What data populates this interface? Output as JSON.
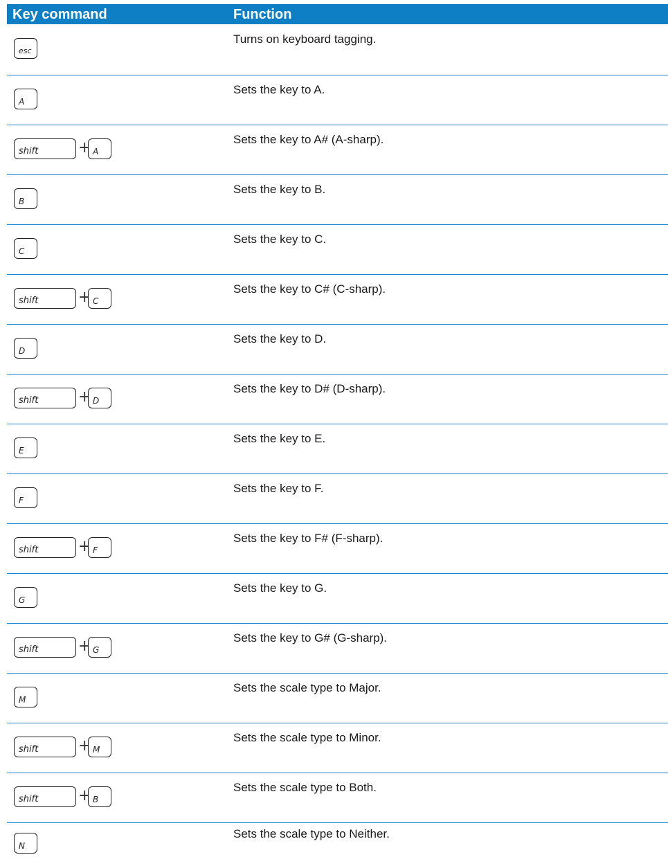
{
  "header": {
    "col1": "Key command",
    "col2": "Function"
  },
  "rows": [
    {
      "keys": [
        "esc"
      ],
      "desc": "Turns on keyboard tagging."
    },
    {
      "keys": [
        "A"
      ],
      "desc": "Sets the key to A."
    },
    {
      "keys": [
        "shift",
        "A"
      ],
      "plus": "+",
      "desc": "Sets the key to A# (A-sharp)."
    },
    {
      "keys": [
        "B"
      ],
      "desc": "Sets the key to B."
    },
    {
      "keys": [
        "C"
      ],
      "desc": "Sets the key to C."
    },
    {
      "keys": [
        "shift",
        "C"
      ],
      "plus": "+",
      "desc": "Sets the key to C# (C-sharp)."
    },
    {
      "keys": [
        "D"
      ],
      "desc": "Sets the key to D."
    },
    {
      "keys": [
        "shift",
        "D"
      ],
      "plus": "+",
      "desc": "Sets the key to D# (D-sharp)."
    },
    {
      "keys": [
        "E"
      ],
      "desc": "Sets the key to E."
    },
    {
      "keys": [
        "F"
      ],
      "desc": "Sets the key to F."
    },
    {
      "keys": [
        "shift",
        "F"
      ],
      "plus": "+",
      "desc": "Sets the key to F# (F-sharp)."
    },
    {
      "keys": [
        "G"
      ],
      "desc": "Sets the key to G."
    },
    {
      "keys": [
        "shift",
        "G"
      ],
      "plus": "+",
      "desc": "Sets the key to G# (G-sharp)."
    },
    {
      "keys": [
        "M"
      ],
      "desc": "Sets the scale type to Major."
    },
    {
      "keys": [
        "shift",
        "M"
      ],
      "plus": "+",
      "desc": "Sets the scale type to Minor."
    },
    {
      "keys": [
        "shift",
        "B"
      ],
      "plus": "+",
      "desc": "Sets the scale type to Both."
    },
    {
      "keys": [
        "N"
      ],
      "desc": "Sets the scale type to Neither."
    }
  ],
  "colors": {
    "header_bg": "#0f7fc5",
    "rule": "#1f86c9",
    "header_text": "#ffffff"
  }
}
